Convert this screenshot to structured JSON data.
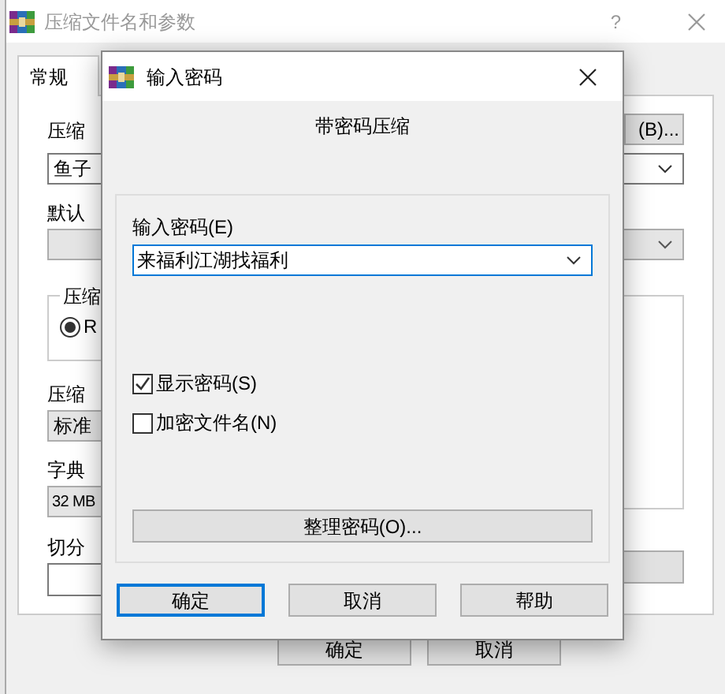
{
  "window": {
    "title": "压缩文件名和参数",
    "help": "?"
  },
  "tabs": [
    {
      "label": "常规",
      "selected": true
    }
  ],
  "general": {
    "archive_name_label": "压缩",
    "archive_name": "鱼子",
    "browse_button": "(B)...",
    "profile_label": "默认",
    "format_group_label": "压缩",
    "format_options": [
      {
        "label": "R",
        "selected": true
      }
    ],
    "method_label": "压缩",
    "method": "标准",
    "dictionary_label": "字典",
    "dictionary": "32 MB",
    "split_label": "切分"
  },
  "buttons": [
    {
      "label": "确定"
    },
    {
      "label": "取消"
    }
  ],
  "password_dialog": {
    "title": "输入密码",
    "heading": "带密码压缩",
    "password_label": "输入密码(E)",
    "password": "来福利江湖找福利",
    "options": [
      {
        "label": "显示密码(S)",
        "checked": true
      },
      {
        "label": "加密文件名(N)",
        "checked": false
      }
    ],
    "organize_button": "整理密码(O)...",
    "buttons": [
      {
        "label": "确定",
        "default": true
      },
      {
        "label": "取消",
        "default": false
      },
      {
        "label": "帮助",
        "default": false
      }
    ]
  }
}
